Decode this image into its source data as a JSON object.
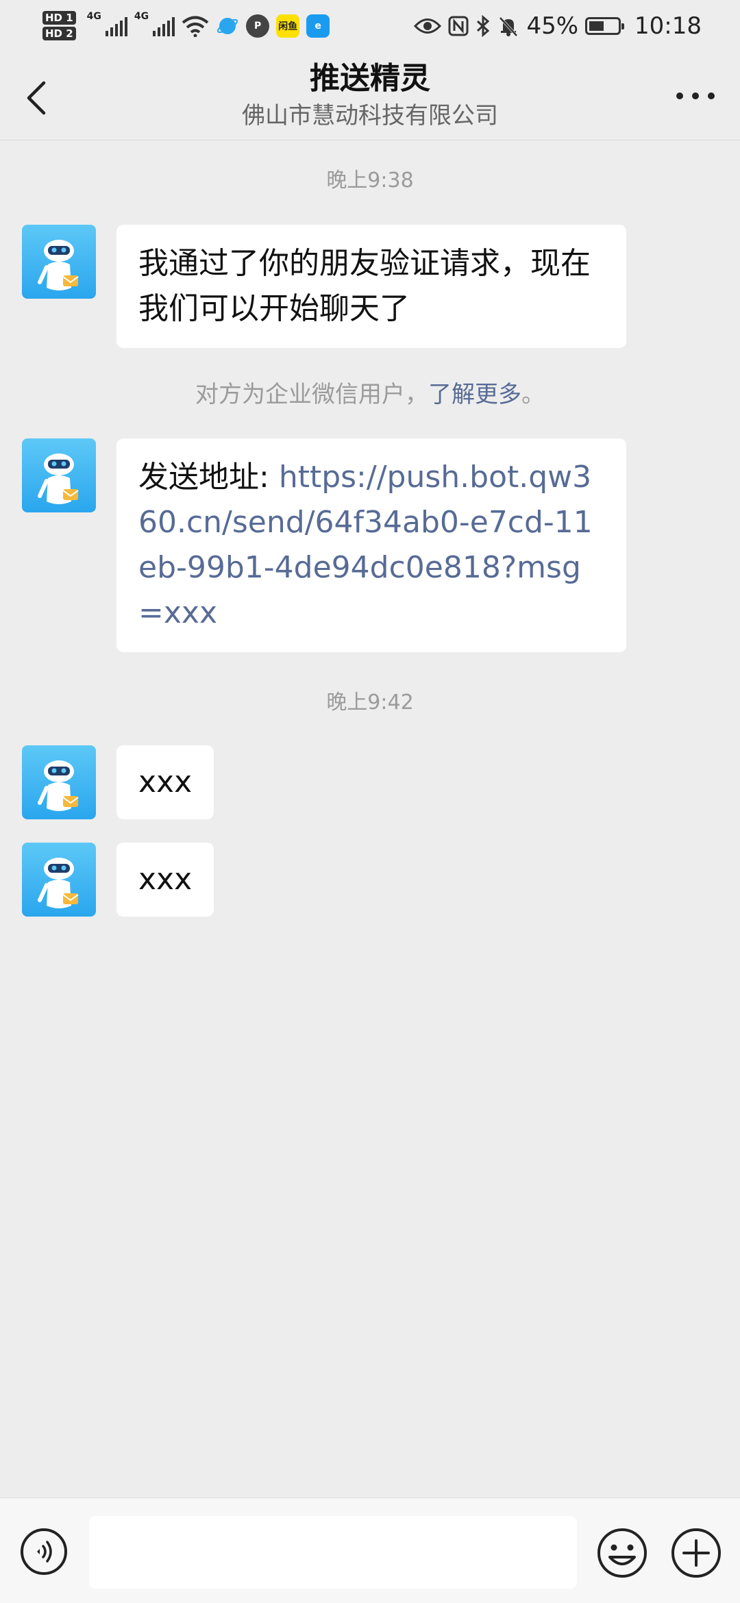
{
  "status_bar": {
    "hd1": "HD 1",
    "hd2": "HD 2",
    "net1": "4G",
    "net2": "4G",
    "app1": "P",
    "app2": "闲鱼",
    "app3": "e",
    "battery_percent": "45%",
    "time": "10:18"
  },
  "header": {
    "title": "推送精灵",
    "subtitle": "佛山市慧动科技有限公司"
  },
  "chat": {
    "timestamp_1": "晚上9:38",
    "message_1": "我通过了你的朋友验证请求，现在我们可以开始聊天了",
    "system_note_text": "对方为企业微信用户，",
    "system_note_link": "了解更多",
    "system_note_end": "。",
    "message_2_prefix": "发送地址: ",
    "message_2_url": "https://push.bot.qw360.cn/send/64f34ab0-e7cd-11eb-99b1-4de94dc0e818?msg=xxx",
    "timestamp_2": "晚上9:42",
    "message_3": "xxx",
    "message_4": "xxx"
  },
  "input": {
    "value": "",
    "placeholder": ""
  },
  "colors": {
    "link": "#576b95",
    "background": "#ededed",
    "avatar_blue": "#2aa6ee"
  }
}
